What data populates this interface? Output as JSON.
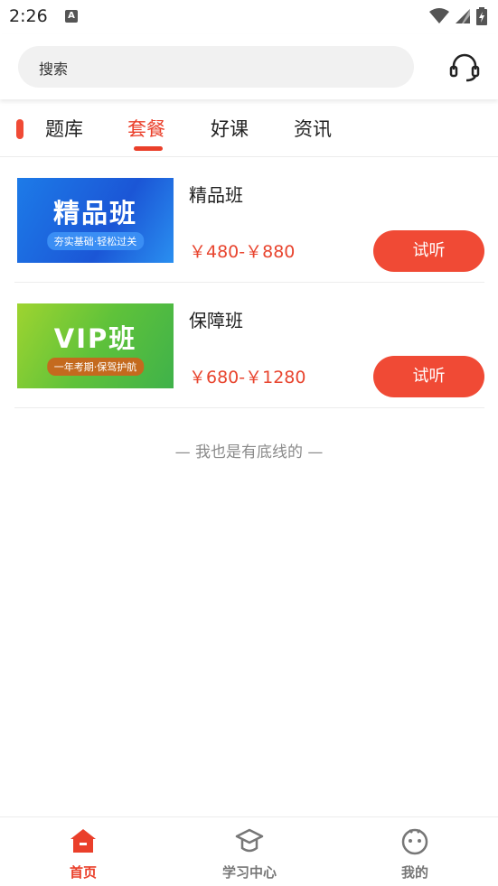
{
  "status_bar": {
    "time": "2:26",
    "notification_letter": "A"
  },
  "search": {
    "placeholder": "搜索"
  },
  "tabs": [
    {
      "label": "题库",
      "active": false
    },
    {
      "label": "套餐",
      "active": true
    },
    {
      "label": "好课",
      "active": false
    },
    {
      "label": "资讯",
      "active": false
    }
  ],
  "courses": [
    {
      "name": "精品班",
      "thumb_title": "精品班",
      "thumb_subtitle": "夯实基础·轻松过关",
      "price": "￥480-￥880",
      "button": "试听"
    },
    {
      "name": "保障班",
      "thumb_title": "VIP班",
      "thumb_subtitle": "一年考期·保驾护航",
      "price": "￥680-￥1280",
      "button": "试听"
    }
  ],
  "end_text": "— 我也是有底线的 —",
  "bottom_nav": [
    {
      "label": "首页",
      "icon": "home-icon",
      "active": true
    },
    {
      "label": "学习中心",
      "icon": "graduation-cap-icon",
      "active": false
    },
    {
      "label": "我的",
      "icon": "smiley-face-icon",
      "active": false
    }
  ],
  "colors": {
    "accent": "#ea3f2a",
    "button": "#f04a35"
  }
}
